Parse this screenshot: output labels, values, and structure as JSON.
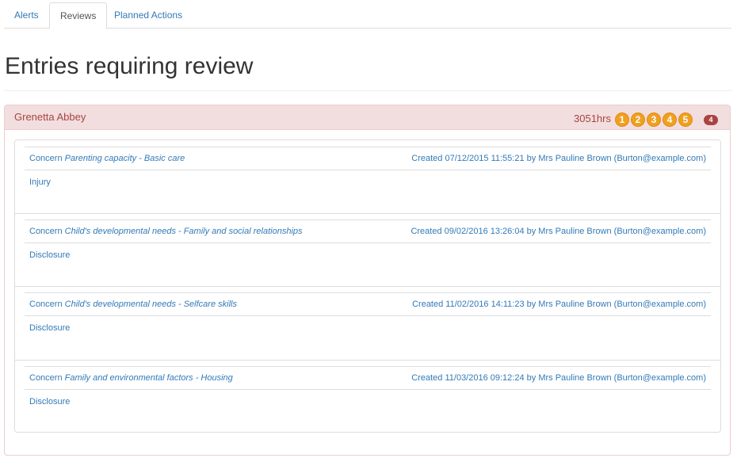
{
  "tabs": [
    {
      "label": "Alerts",
      "active": false
    },
    {
      "label": "Reviews",
      "active": true
    },
    {
      "label": "Planned Actions",
      "active": false
    }
  ],
  "page_title": "Entries requiring review",
  "panel": {
    "name": "Grenetta Abbey",
    "hours": "3051hrs",
    "circles": [
      "1",
      "2",
      "3",
      "4",
      "5"
    ],
    "badge_count": "4",
    "color_heading_bg": "#f2dede",
    "color_heading_text": "#a94442",
    "color_circle": "#f0a020"
  },
  "entries": [
    {
      "concern_prefix": "Concern",
      "concern_topic": "Parenting capacity - Basic care",
      "created": "Created 07/12/2015 11:55:21 by Mrs Pauline Brown (Burton@example.com)",
      "body": "Injury"
    },
    {
      "concern_prefix": "Concern",
      "concern_topic": "Child's developmental needs - Family and social relationships",
      "created": "Created 09/02/2016 13:26:04 by Mrs Pauline Brown (Burton@example.com)",
      "body": "Disclosure"
    },
    {
      "concern_prefix": "Concern",
      "concern_topic": "Child's developmental needs - Selfcare skills",
      "created": "Created 11/02/2016 14:11:23 by Mrs Pauline Brown (Burton@example.com)",
      "body": "Disclosure"
    },
    {
      "concern_prefix": "Concern",
      "concern_topic": "Family and environmental factors - Housing",
      "created": "Created 11/03/2016 09:12:24 by Mrs Pauline Brown (Burton@example.com)",
      "body": "Disclosure"
    }
  ]
}
